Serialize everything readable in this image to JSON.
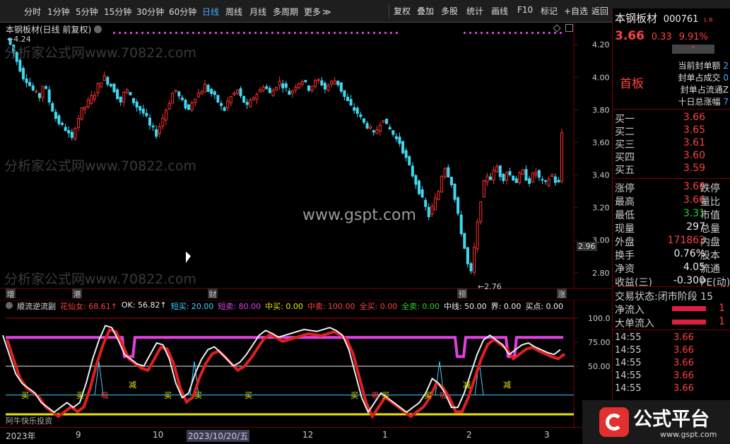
{
  "toolbar": {
    "periods": [
      "分时",
      "1分钟",
      "5分钟",
      "15分钟",
      "30分钟",
      "60分钟",
      "日线",
      "周线",
      "月线",
      "多周期",
      "更多"
    ],
    "active_period": "日线",
    "more_arrow": "≫",
    "actions": [
      "复权",
      "叠加",
      "多股",
      "统计",
      "画线",
      "F10",
      "标记",
      "+自选",
      "返回"
    ]
  },
  "chart": {
    "stock_title": "本钢板材(日线 前复权)",
    "high_label": "4.24",
    "low_label": "2.76",
    "price_axis": [
      "4.20",
      "4.00",
      "3.80",
      "3.60",
      "3.40",
      "3.20",
      "3.00",
      "2.80"
    ],
    "price_box": "2.96",
    "watermarks": [
      "分析家公式网www.70822.com",
      "分析家公式网www.70822.com",
      "分析家公式网www.70822.com"
    ],
    "gspt": "www.gspt.com",
    "event_markers": [
      {
        "text": "增",
        "color": "#e6e600"
      },
      {
        "text": "港",
        "color": "#e6a000"
      },
      {
        "text": "财",
        "color": "#4aa8ff"
      },
      {
        "text": "预",
        "color": "#e6a000"
      },
      {
        "text": "涨",
        "color": "#ff4040"
      }
    ]
  },
  "indicator": {
    "name": "顺流逆流副",
    "legend": [
      {
        "label": "花仙女: 68.61↑",
        "color": "#ff4040"
      },
      {
        "label": "OK: 56.82↑",
        "color": "#eeeeee"
      },
      {
        "label": "短买: 20.00",
        "color": "#40d0ff"
      },
      {
        "label": "短卖: 80.00",
        "color": "#e040e0"
      },
      {
        "label": "中买: 0.00",
        "color": "#e6e600"
      },
      {
        "label": "中卖: 100.00",
        "color": "#ff4040"
      },
      {
        "label": "全买: 0.00",
        "color": "#ff4040"
      },
      {
        "label": "全卖: 0.00",
        "color": "#2ad02a"
      },
      {
        "label": "中线: 50.00",
        "color": "#eeeeee"
      },
      {
        "label": "界: 0.00",
        "color": "#eeeeee"
      },
      {
        "label": "买点: 0.00",
        "color": "#eeeeee"
      }
    ],
    "axis": [
      "100.0",
      "75.00",
      "50.00"
    ],
    "signals": [
      {
        "text": "买",
        "color": "#e6e600"
      },
      {
        "text": "买",
        "color": "#e6e600"
      },
      {
        "text": "吸",
        "color": "#ff4040"
      },
      {
        "text": "减",
        "color": "#e6e600"
      },
      {
        "text": "买",
        "color": "#e6e600"
      },
      {
        "text": "买",
        "color": "#e6e600"
      },
      {
        "text": "买",
        "color": "#e6e600"
      },
      {
        "text": "买",
        "color": "#e6e600"
      },
      {
        "text": "吸",
        "color": "#ff4040"
      },
      {
        "text": "买",
        "color": "#e6e600"
      },
      {
        "text": "买",
        "color": "#e6e600"
      },
      {
        "text": "吸",
        "color": "#ff4040"
      },
      {
        "text": "减",
        "color": "#e6e600"
      },
      {
        "text": "减",
        "color": "#e6e600"
      }
    ],
    "author": "阿牛快乐投资"
  },
  "xaxis": {
    "labels": [
      "2023年",
      "9",
      "10",
      "2023/10/20/五",
      "12",
      "1",
      "2",
      "3"
    ]
  },
  "panel": {
    "stock_name": "本钢板材",
    "stock_code": "000761",
    "flags": "L R",
    "price": "3.66",
    "change": "0.33",
    "change_pct": "9.91%",
    "up_arrow": "⌃",
    "board": "首板",
    "seal_info": [
      {
        "label": "当前封单额",
        "value": "2"
      },
      {
        "label": "封单占成交",
        "value": "0"
      },
      {
        "label": "封单占流通Z",
        "value": ""
      },
      {
        "label": "十日总涨幅",
        "value": "7"
      }
    ],
    "bids": [
      {
        "label": "买一",
        "price": "3.66",
        "vol": ""
      },
      {
        "label": "买二",
        "price": "3.65",
        "vol": ""
      },
      {
        "label": "买三",
        "price": "3.61",
        "vol": ""
      },
      {
        "label": "买四",
        "price": "3.60",
        "vol": ""
      },
      {
        "label": "买五",
        "price": "3.59",
        "vol": ""
      }
    ],
    "stats": [
      {
        "l": "涨停",
        "v": "3.66",
        "vc": "red",
        "r": "跌停"
      },
      {
        "l": "最高",
        "v": "3.66",
        "vc": "red",
        "r": "量比"
      },
      {
        "l": "最低",
        "v": "3.31",
        "vc": "green",
        "r": "市值"
      },
      {
        "l": "现量",
        "v": "297",
        "vc": "white",
        "r": "总量"
      },
      {
        "l": "外盘",
        "v": "171863",
        "vc": "red",
        "r": "内盘"
      },
      {
        "l": "换手",
        "v": "0.76%",
        "vc": "white",
        "r": "股本"
      },
      {
        "l": "净资",
        "v": "4.05",
        "vc": "white",
        "r": "流通"
      },
      {
        "l": "收益(三)",
        "v": "-0.300",
        "vc": "white",
        "r": "PE(动)"
      }
    ],
    "trade_status_label": "交易状态:",
    "trade_status": "闭市阶段 15",
    "flows": [
      {
        "l": "净流入",
        "v": "1"
      },
      {
        "l": "大单流入",
        "v": "1"
      }
    ],
    "ticks": [
      {
        "t": "14:55",
        "p": "3.66"
      },
      {
        "t": "14:55",
        "p": "3.66"
      },
      {
        "t": "14:55",
        "p": "3.66"
      },
      {
        "t": "14:55",
        "p": "3.66"
      },
      {
        "t": "14:55",
        "p": "3.66"
      }
    ]
  },
  "logo": {
    "text": "公式平台",
    "url": "www.gspt.com"
  }
}
